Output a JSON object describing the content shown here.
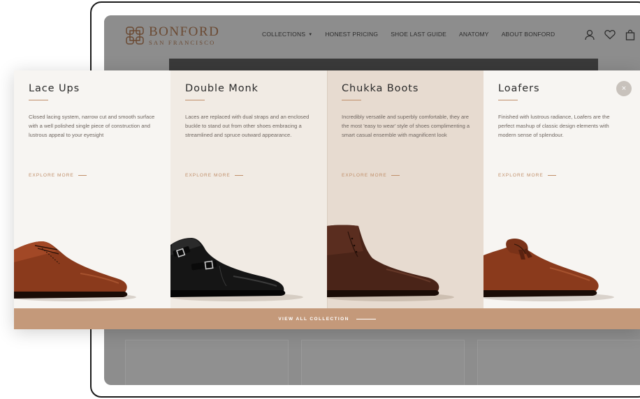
{
  "brand": {
    "name": "BONFORD",
    "tagline": "SAN FRANCISCO"
  },
  "nav": {
    "items": [
      {
        "label": "COLLECTIONS",
        "has_caret": true
      },
      {
        "label": "HONEST PRICING"
      },
      {
        "label": "SHOE LAST GUIDE"
      },
      {
        "label": "ANATOMY"
      },
      {
        "label": "ABOUT BONFORD"
      }
    ]
  },
  "header_icons": [
    "account-icon",
    "wishlist-heart-icon",
    "shopping-bag-icon"
  ],
  "mega_menu": {
    "columns": [
      {
        "title": "Lace Ups",
        "description": "Closed lacing system, narrow cut and smooth surface with a well polished single piece of construction and lustrous appeal to your eyesight",
        "cta": "EXPLORE MORE",
        "bg": "#f7f5f2"
      },
      {
        "title": "Double Monk",
        "description": "Laces are replaced with dual straps and an enclosed buckle to stand out from other shoes embracing a streamlined and spruce outward appearance.",
        "cta": "EXPLORE MORE",
        "bg": "#f1ebe4"
      },
      {
        "title": "Chukka Boots",
        "description": "Incredibly versatile and superbly comfortable, they are the most 'easy to wear' style of shoes complimenting a smart casual ensemble with magnificent look",
        "cta": "EXPLORE MORE",
        "bg": "#e7dbd0"
      },
      {
        "title": "Loafers",
        "description": "Finished with lustrous radiance, Loafers are the perfect mashup of classic design elements with modern sense of splendour.",
        "cta": "EXPLORE MORE",
        "bg": "#f7f5f2"
      }
    ],
    "close_icon": "close-icon",
    "close_glyph": "×",
    "view_all": "VIEW ALL COLLECTION",
    "accent": "#c4997a"
  }
}
